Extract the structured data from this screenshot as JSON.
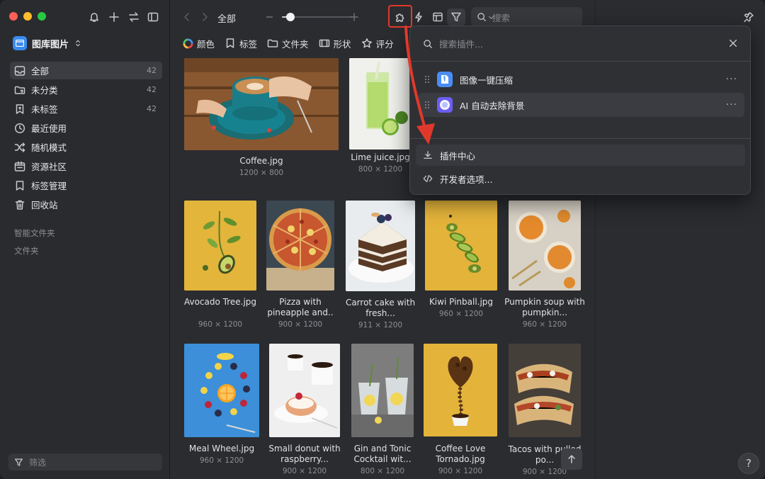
{
  "sidebar": {
    "library": "图库图片",
    "items": [
      {
        "label": "全部",
        "count": "42",
        "icon": "inbox-icon"
      },
      {
        "label": "未分类",
        "count": "42",
        "icon": "folder-question-icon"
      },
      {
        "label": "未标签",
        "count": "42",
        "icon": "bookmark-question-icon"
      },
      {
        "label": "最近使用",
        "icon": "clock-icon"
      },
      {
        "label": "随机模式",
        "icon": "shuffle-icon"
      },
      {
        "label": "资源社区",
        "icon": "community-icon"
      },
      {
        "label": "标签管理",
        "icon": "bookmark-icon"
      },
      {
        "label": "回收站",
        "icon": "trash-icon"
      }
    ],
    "sections": [
      "智能文件夹",
      "文件夹"
    ],
    "filter_placeholder": "筛选"
  },
  "toolbar": {
    "breadcrumb": "全部",
    "zoom_level": 0.12,
    "search_placeholder": "搜索"
  },
  "filter_chips": [
    "颜色",
    "标签",
    "文件夹",
    "形状",
    "评分"
  ],
  "grid": {
    "items": [
      {
        "name": "Coffee.jpg",
        "dims": "1200 × 800"
      },
      {
        "name": "Lime juice.jpg",
        "dims": "800 × 1200"
      },
      {
        "name": "Avocado Tree.jpg",
        "dims": "960 × 1200"
      },
      {
        "name": "Pizza with pineapple and..",
        "dims": "900 × 1200"
      },
      {
        "name": "Carrot cake with fresh...",
        "dims": "911 × 1200"
      },
      {
        "name": "Kiwi Pinball.jpg",
        "dims": "960 × 1200"
      },
      {
        "name": "Pumpkin soup with pumpkin...",
        "dims": "960 × 1200"
      },
      {
        "name": "Meal Wheel.jpg",
        "dims": "960 × 1200"
      },
      {
        "name": "Small donut with raspberry...",
        "dims": "900 × 1200"
      },
      {
        "name": "Gin and Tonic Cocktail wit...",
        "dims": "800 × 1200"
      },
      {
        "name": "Coffee Love Tornado.jpg",
        "dims": "900 × 1200"
      },
      {
        "name": "Tacos with pulled po...",
        "dims": "900 × 1200"
      }
    ]
  },
  "plugin_popup": {
    "search_placeholder": "搜索插件...",
    "plugins": [
      "图像一键压缩",
      "AI 自动去除背景"
    ],
    "plugin_center": "插件中心",
    "developer_options": "开发者选项..."
  },
  "help_label": "?",
  "colors": {
    "annotation_red": "#e0392b",
    "accent_blue": "#3a8bf0"
  }
}
